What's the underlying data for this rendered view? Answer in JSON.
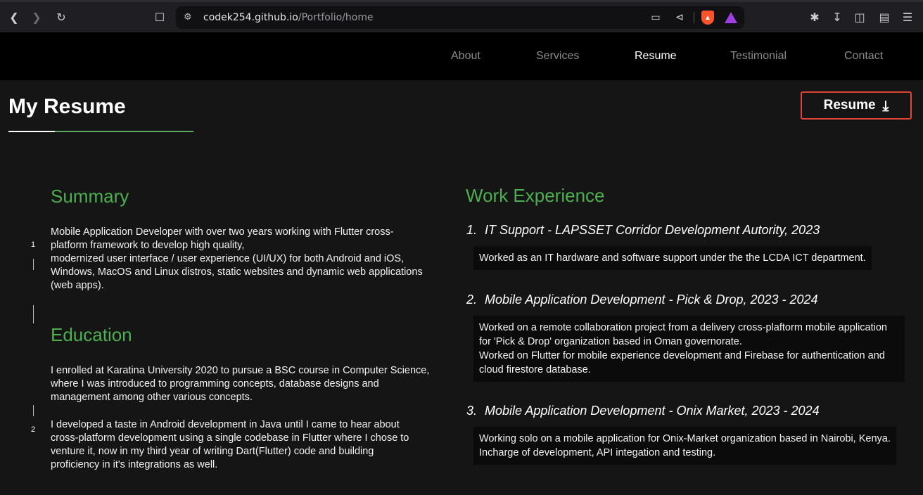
{
  "browser": {
    "url_host": "codek254.github.io",
    "url_path": "/Portfolio/home"
  },
  "nav": {
    "items": [
      "About",
      "Services",
      "Resume",
      "Testimonial",
      "Contact"
    ],
    "active": "Resume"
  },
  "header": {
    "title": "My Resume",
    "resume_button": "Resume"
  },
  "summary": {
    "heading": "Summary",
    "text_lines": [
      "Mobile Application Developer with over two years working with Flutter cross-",
      "platform framework to develop high quality,",
      "modernized user interface / user experience (UI/UX) for both Android and iOS,",
      "Windows, MacOS and Linux distros, static websites and dynamic web applications",
      "(web apps)."
    ]
  },
  "education": {
    "heading": "Education",
    "para1_lines": [
      "I enrolled at Karatina University 2020 to pursue a BSC course in Computer Science,",
      "where I was introduced to programming concepts, database designs and",
      "management among other various concepts."
    ],
    "para2_lines": [
      "I developed a taste in Android development in Java until I came to hear about",
      "cross-platform development using a single codebase in Flutter where I chose to",
      "venture it, now in my third year of writing Dart(Flutter) code and building",
      "proficiency in it's integrations as well."
    ]
  },
  "timeline": {
    "markers": [
      "1",
      "2"
    ]
  },
  "work": {
    "heading": "Work Experience",
    "jobs": [
      {
        "number": "1.",
        "title": "IT Support - LAPSSET Corridor Development Autority, 2023",
        "desc_lines": [
          "Worked as an IT hardware and software support under the the LCDA ICT department."
        ]
      },
      {
        "number": "2.",
        "title": "Mobile Application Development - Pick & Drop, 2023 - 2024",
        "desc_lines": [
          "Worked on a remote collaboration project from a delivery cross-plaftorm mobile application",
          "for 'Pick & Drop' organization based in Oman governorate.",
          "Worked on Flutter for mobile experience development and Firebase for authentication and",
          "cloud firestore database."
        ]
      },
      {
        "number": "3.",
        "title": "Mobile Application Development - Onix Market, 2023 - 2024",
        "desc_lines": [
          "Working solo on a mobile application for Onix-Market organization based in Nairobi, Kenya.",
          "Incharge of development, API integation and testing."
        ]
      }
    ]
  },
  "colors": {
    "accent_green": "#4caf50",
    "button_border": "#e0453a",
    "background": "#151515"
  }
}
